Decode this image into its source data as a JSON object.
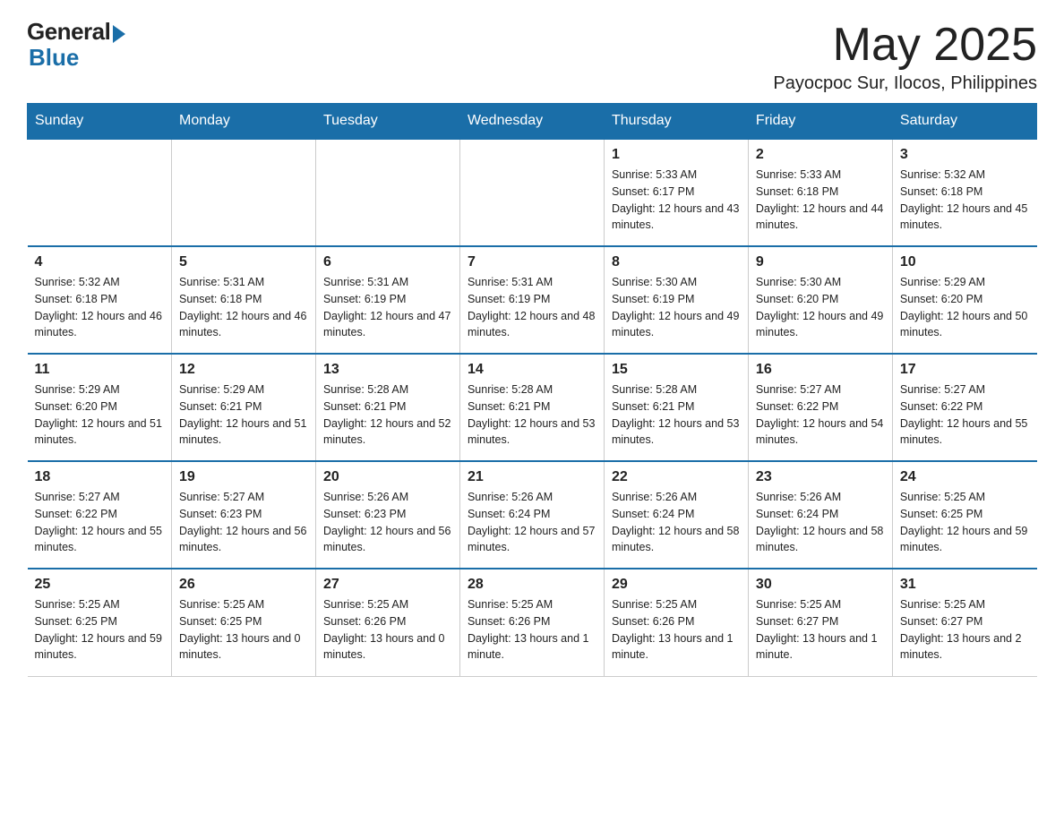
{
  "logo": {
    "general": "General",
    "blue": "Blue"
  },
  "header": {
    "month_year": "May 2025",
    "location": "Payocpoc Sur, Ilocos, Philippines"
  },
  "weekdays": [
    "Sunday",
    "Monday",
    "Tuesday",
    "Wednesday",
    "Thursday",
    "Friday",
    "Saturday"
  ],
  "weeks": [
    [
      {
        "day": "",
        "sunrise": "",
        "sunset": "",
        "daylight": ""
      },
      {
        "day": "",
        "sunrise": "",
        "sunset": "",
        "daylight": ""
      },
      {
        "day": "",
        "sunrise": "",
        "sunset": "",
        "daylight": ""
      },
      {
        "day": "",
        "sunrise": "",
        "sunset": "",
        "daylight": ""
      },
      {
        "day": "1",
        "sunrise": "Sunrise: 5:33 AM",
        "sunset": "Sunset: 6:17 PM",
        "daylight": "Daylight: 12 hours and 43 minutes."
      },
      {
        "day": "2",
        "sunrise": "Sunrise: 5:33 AM",
        "sunset": "Sunset: 6:18 PM",
        "daylight": "Daylight: 12 hours and 44 minutes."
      },
      {
        "day": "3",
        "sunrise": "Sunrise: 5:32 AM",
        "sunset": "Sunset: 6:18 PM",
        "daylight": "Daylight: 12 hours and 45 minutes."
      }
    ],
    [
      {
        "day": "4",
        "sunrise": "Sunrise: 5:32 AM",
        "sunset": "Sunset: 6:18 PM",
        "daylight": "Daylight: 12 hours and 46 minutes."
      },
      {
        "day": "5",
        "sunrise": "Sunrise: 5:31 AM",
        "sunset": "Sunset: 6:18 PM",
        "daylight": "Daylight: 12 hours and 46 minutes."
      },
      {
        "day": "6",
        "sunrise": "Sunrise: 5:31 AM",
        "sunset": "Sunset: 6:19 PM",
        "daylight": "Daylight: 12 hours and 47 minutes."
      },
      {
        "day": "7",
        "sunrise": "Sunrise: 5:31 AM",
        "sunset": "Sunset: 6:19 PM",
        "daylight": "Daylight: 12 hours and 48 minutes."
      },
      {
        "day": "8",
        "sunrise": "Sunrise: 5:30 AM",
        "sunset": "Sunset: 6:19 PM",
        "daylight": "Daylight: 12 hours and 49 minutes."
      },
      {
        "day": "9",
        "sunrise": "Sunrise: 5:30 AM",
        "sunset": "Sunset: 6:20 PM",
        "daylight": "Daylight: 12 hours and 49 minutes."
      },
      {
        "day": "10",
        "sunrise": "Sunrise: 5:29 AM",
        "sunset": "Sunset: 6:20 PM",
        "daylight": "Daylight: 12 hours and 50 minutes."
      }
    ],
    [
      {
        "day": "11",
        "sunrise": "Sunrise: 5:29 AM",
        "sunset": "Sunset: 6:20 PM",
        "daylight": "Daylight: 12 hours and 51 minutes."
      },
      {
        "day": "12",
        "sunrise": "Sunrise: 5:29 AM",
        "sunset": "Sunset: 6:21 PM",
        "daylight": "Daylight: 12 hours and 51 minutes."
      },
      {
        "day": "13",
        "sunrise": "Sunrise: 5:28 AM",
        "sunset": "Sunset: 6:21 PM",
        "daylight": "Daylight: 12 hours and 52 minutes."
      },
      {
        "day": "14",
        "sunrise": "Sunrise: 5:28 AM",
        "sunset": "Sunset: 6:21 PM",
        "daylight": "Daylight: 12 hours and 53 minutes."
      },
      {
        "day": "15",
        "sunrise": "Sunrise: 5:28 AM",
        "sunset": "Sunset: 6:21 PM",
        "daylight": "Daylight: 12 hours and 53 minutes."
      },
      {
        "day": "16",
        "sunrise": "Sunrise: 5:27 AM",
        "sunset": "Sunset: 6:22 PM",
        "daylight": "Daylight: 12 hours and 54 minutes."
      },
      {
        "day": "17",
        "sunrise": "Sunrise: 5:27 AM",
        "sunset": "Sunset: 6:22 PM",
        "daylight": "Daylight: 12 hours and 55 minutes."
      }
    ],
    [
      {
        "day": "18",
        "sunrise": "Sunrise: 5:27 AM",
        "sunset": "Sunset: 6:22 PM",
        "daylight": "Daylight: 12 hours and 55 minutes."
      },
      {
        "day": "19",
        "sunrise": "Sunrise: 5:27 AM",
        "sunset": "Sunset: 6:23 PM",
        "daylight": "Daylight: 12 hours and 56 minutes."
      },
      {
        "day": "20",
        "sunrise": "Sunrise: 5:26 AM",
        "sunset": "Sunset: 6:23 PM",
        "daylight": "Daylight: 12 hours and 56 minutes."
      },
      {
        "day": "21",
        "sunrise": "Sunrise: 5:26 AM",
        "sunset": "Sunset: 6:24 PM",
        "daylight": "Daylight: 12 hours and 57 minutes."
      },
      {
        "day": "22",
        "sunrise": "Sunrise: 5:26 AM",
        "sunset": "Sunset: 6:24 PM",
        "daylight": "Daylight: 12 hours and 58 minutes."
      },
      {
        "day": "23",
        "sunrise": "Sunrise: 5:26 AM",
        "sunset": "Sunset: 6:24 PM",
        "daylight": "Daylight: 12 hours and 58 minutes."
      },
      {
        "day": "24",
        "sunrise": "Sunrise: 5:25 AM",
        "sunset": "Sunset: 6:25 PM",
        "daylight": "Daylight: 12 hours and 59 minutes."
      }
    ],
    [
      {
        "day": "25",
        "sunrise": "Sunrise: 5:25 AM",
        "sunset": "Sunset: 6:25 PM",
        "daylight": "Daylight: 12 hours and 59 minutes."
      },
      {
        "day": "26",
        "sunrise": "Sunrise: 5:25 AM",
        "sunset": "Sunset: 6:25 PM",
        "daylight": "Daylight: 13 hours and 0 minutes."
      },
      {
        "day": "27",
        "sunrise": "Sunrise: 5:25 AM",
        "sunset": "Sunset: 6:26 PM",
        "daylight": "Daylight: 13 hours and 0 minutes."
      },
      {
        "day": "28",
        "sunrise": "Sunrise: 5:25 AM",
        "sunset": "Sunset: 6:26 PM",
        "daylight": "Daylight: 13 hours and 1 minute."
      },
      {
        "day": "29",
        "sunrise": "Sunrise: 5:25 AM",
        "sunset": "Sunset: 6:26 PM",
        "daylight": "Daylight: 13 hours and 1 minute."
      },
      {
        "day": "30",
        "sunrise": "Sunrise: 5:25 AM",
        "sunset": "Sunset: 6:27 PM",
        "daylight": "Daylight: 13 hours and 1 minute."
      },
      {
        "day": "31",
        "sunrise": "Sunrise: 5:25 AM",
        "sunset": "Sunset: 6:27 PM",
        "daylight": "Daylight: 13 hours and 2 minutes."
      }
    ]
  ]
}
